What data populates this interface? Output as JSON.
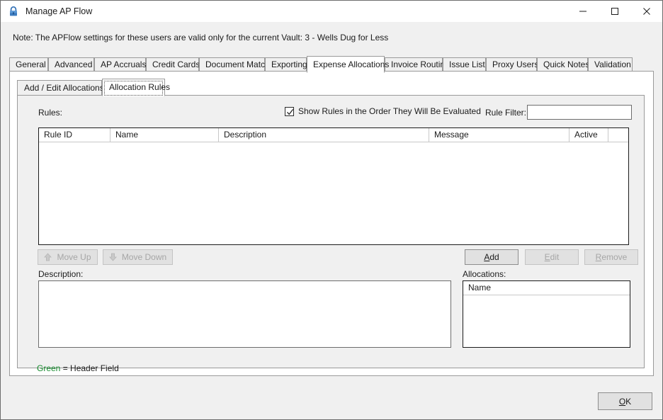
{
  "window": {
    "title": "Manage AP Flow",
    "icon": "lock-icon",
    "minimize_label": "—",
    "maximize_label": "□",
    "close_label": "✕",
    "accent_green": "#12892a",
    "lock_blue": "#2f6fb5"
  },
  "note": {
    "text": "Note:  The APFlow settings for these users are valid only for the current Vault: 3 - Wells Dug for Less"
  },
  "tabs": [
    {
      "label": "General",
      "active": false
    },
    {
      "label": "Advanced",
      "active": false
    },
    {
      "label": "AP Accruals",
      "active": false
    },
    {
      "label": "Credit Cards",
      "active": false
    },
    {
      "label": "Document Match",
      "active": false
    },
    {
      "label": "Exporting",
      "active": false
    },
    {
      "label": "Expense Allocations",
      "active": true
    },
    {
      "label": "Invoice Routing",
      "active": false
    },
    {
      "label": "Issue List",
      "active": false
    },
    {
      "label": "Proxy Users",
      "active": false
    },
    {
      "label": "Quick Notes",
      "active": false
    },
    {
      "label": "Validation",
      "active": false
    }
  ],
  "subtabs": [
    {
      "label": "Add / Edit Allocations",
      "active": false
    },
    {
      "label": "Allocation Rules",
      "active": true
    }
  ],
  "rules_section": {
    "label": "Rules:",
    "show_order_checkbox": {
      "label": "Show Rules in the Order They Will Be Evaluated",
      "checked": true
    },
    "rule_filter": {
      "label": "Rule Filter:",
      "value": "",
      "placeholder": ""
    },
    "columns": [
      {
        "label": "Rule ID"
      },
      {
        "label": "Name"
      },
      {
        "label": "Description"
      },
      {
        "label": "Message"
      },
      {
        "label": "Active"
      },
      {
        "label": ""
      }
    ],
    "rows": []
  },
  "rule_buttons": {
    "move_up": {
      "label": "Move Up",
      "icon": "arrow-up-icon",
      "enabled": false
    },
    "move_down": {
      "label": "Move Down",
      "icon": "arrow-down-icon",
      "enabled": false
    },
    "add": {
      "label": "Add",
      "mnemonic": "A",
      "enabled": true
    },
    "edit": {
      "label": "Edit",
      "mnemonic": "E",
      "enabled": false
    },
    "remove": {
      "label": "Remove",
      "mnemonic": "R",
      "enabled": false
    }
  },
  "description": {
    "label": "Description:",
    "value": ""
  },
  "allocations": {
    "label": "Allocations:",
    "columns": [
      {
        "label": "Name"
      }
    ],
    "rows": []
  },
  "legend": {
    "green_word": "Green",
    "rest_text": "  =  Header Field"
  },
  "footer": {
    "ok_label": "OK",
    "ok_mnemonic": "O"
  }
}
